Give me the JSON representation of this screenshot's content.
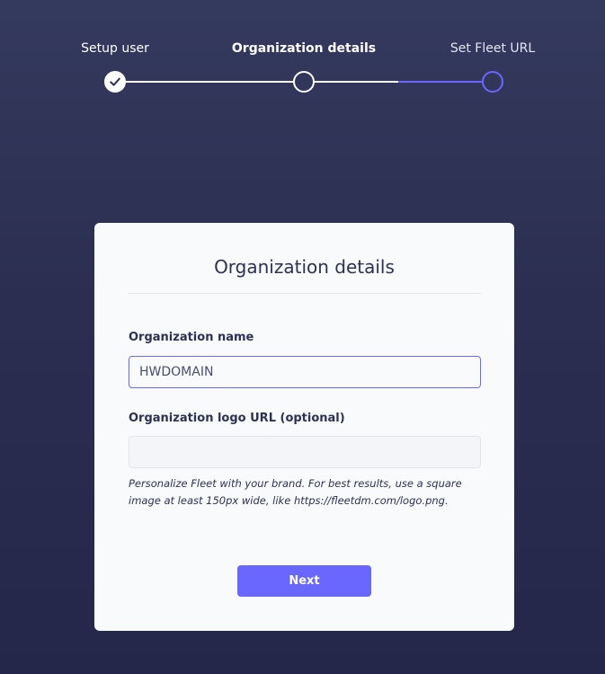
{
  "stepper": {
    "steps": [
      {
        "label": "Setup user",
        "state": "done",
        "icon": "check-icon"
      },
      {
        "label": "Organization details",
        "state": "current"
      },
      {
        "label": "Set Fleet URL",
        "state": "pending"
      }
    ]
  },
  "card": {
    "title": "Organization details",
    "org_name": {
      "label": "Organization name",
      "value": "HWDOMAIN",
      "placeholder": ""
    },
    "logo_url": {
      "label": "Organization logo URL (optional)",
      "value": "",
      "placeholder": ""
    },
    "help_text": "Personalize Fleet with your brand. For best results, use a square image at least 150px wide, like https://fleetdm.com/logo.png.",
    "next_label": "Next"
  },
  "colors": {
    "background_top": "#343a5e",
    "background_bottom": "#25274a",
    "accent": "#6a67fe",
    "card_background": "#f9fafc",
    "text_dark": "#2d3152"
  }
}
